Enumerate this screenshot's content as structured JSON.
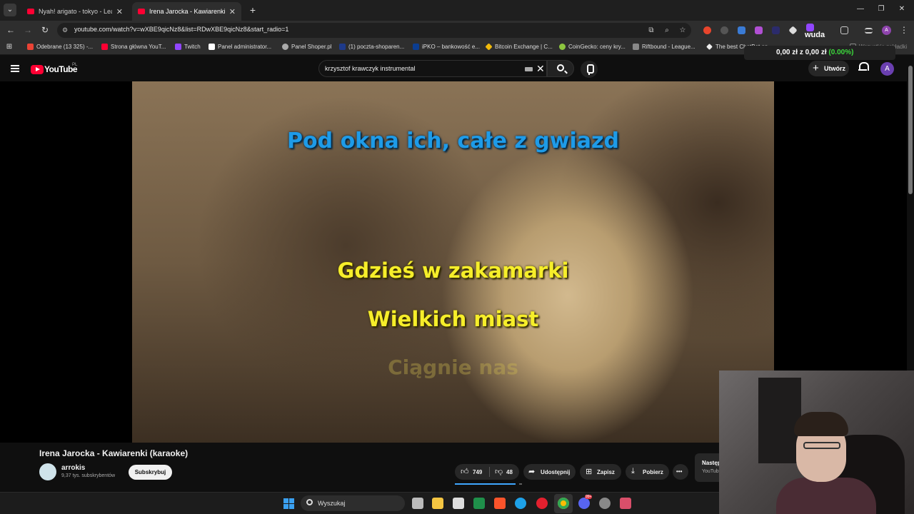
{
  "browser": {
    "tabs": [
      {
        "title": "Nyah! arigato - tokyo - Leat'eq",
        "active": false
      },
      {
        "title": "Irena Jarocka - Kawiarenki (kara",
        "active": true
      }
    ],
    "url": "youtube.com/watch?v=wXBE9qicNz8&list=RDwXBE9qicNz8&start_radio=1",
    "profile_initial": "A",
    "extension_label": "wuda",
    "bookmarks": [
      "Odebrane (13 325) -...",
      "Strona główna YouT...",
      "Twitch",
      "Panel administrator...",
      "Panel Shoper.pl",
      "(1) poczta-shoparen...",
      "iPKO – bankowość e...",
      "Bitcoin Exchange | C...",
      "CoinGecko: ceny kry...",
      "Riftbound - League...",
      "The best ChatBot an...",
      "Wszystkie zakładki"
    ],
    "price_widget": {
      "left": "0,00 zł",
      "sep": "z",
      "right": "0,00 zł",
      "pct": "(0.00%)"
    }
  },
  "youtube": {
    "logo_text": "YouTube",
    "country": "PL",
    "search_query": "krzysztof krawczyk instrumental",
    "create_label": "Utwórz",
    "avatar_initial": "A"
  },
  "video": {
    "lyrics": {
      "line1": "Pod okna ich, całe z gwiazd",
      "line2": "Gdzieś w zakamarki",
      "line3": "Wielkich miast",
      "line4": "Ciągnie nas"
    },
    "title": "Irena Jarocka - Kawiarenki (karaoke)",
    "channel": "arrokis",
    "subscribers": "9,37 tys. subskrybentów",
    "subscribe_label": "Subskrybuj",
    "likes": "749",
    "dislikes": "48",
    "like_ratio": 0.94,
    "share_label": "Udostępnij",
    "save_label": "Zapisz",
    "download_label": "Pobierz",
    "more_label": "•••",
    "next_label": "Następ",
    "next_source": "YouTub"
  },
  "taskbar": {
    "search_label": "Wyszukaj",
    "notification_badge": "99+"
  }
}
